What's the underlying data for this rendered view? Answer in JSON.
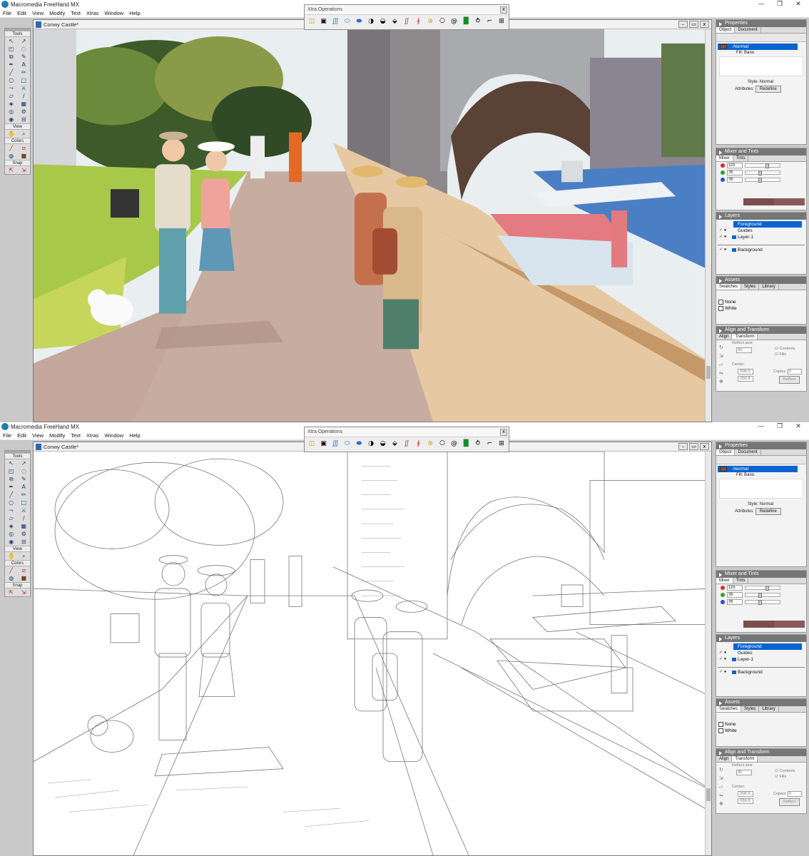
{
  "app": {
    "title": "Macromedia FreeHand MX",
    "window_controls": {
      "minimize": "—",
      "restore": "❐",
      "close": "✕"
    }
  },
  "menu": [
    "File",
    "Edit",
    "View",
    "Modify",
    "Text",
    "Xtras",
    "Window",
    "Help"
  ],
  "document": {
    "title": "Conwy Castle*",
    "controls": {
      "minimize": "–",
      "restore": "▭",
      "close": "x"
    }
  },
  "tools_panel": {
    "title": "Tools",
    "sections": {
      "view": "View",
      "colors": "Colors",
      "snap": "Snap"
    }
  },
  "xtra_operations": {
    "title": "Xtra Operations",
    "close": "x"
  },
  "properties_panel": {
    "title": "Properties",
    "tabs": [
      "Object",
      "Document"
    ],
    "selected_item": "-Normal",
    "fill_item": "Fill: Basic",
    "style_label": "Style: Normal",
    "attributes_label": "Attributes:",
    "redefine_button": "Redefine"
  },
  "mixer_panel": {
    "title": "Mixer and Tints",
    "tabs": [
      "Mixer",
      "Tints"
    ],
    "channels": [
      {
        "value": "123",
        "color": "#d42a2a"
      },
      {
        "value": "78",
        "color": "#2da22d"
      },
      {
        "value": "78",
        "color": "#2a52c9"
      }
    ],
    "mixed_color": "#7b4e4e",
    "mixed_color_alt": "#8a5a5a"
  },
  "layers_panel": {
    "title": "Layers",
    "layers": [
      "Foreground",
      "Guides",
      "Layer-1"
    ],
    "background_layer": "Background"
  },
  "assets_panel": {
    "title": "Assets",
    "tabs": [
      "Swatches",
      "Styles",
      "Library"
    ],
    "swatches": [
      "None",
      "White"
    ]
  },
  "align_panel": {
    "title": "Align and Transform",
    "tabs": [
      "Align",
      "Transform"
    ],
    "reflect_axis_label": "Reflect axis:",
    "reflect_axis_value": "90",
    "contents_label": "Contents",
    "fills_label": "Fills",
    "center_label": "Center:",
    "center_x": "-596.9",
    "center_y": "-556.8",
    "copies_label": "Copies:",
    "copies_value": "0",
    "reflect_button": "Reflect"
  },
  "colors": {
    "accent": "#0b63cf",
    "panel_header": "#767676",
    "sky": "#f0f5f8"
  }
}
